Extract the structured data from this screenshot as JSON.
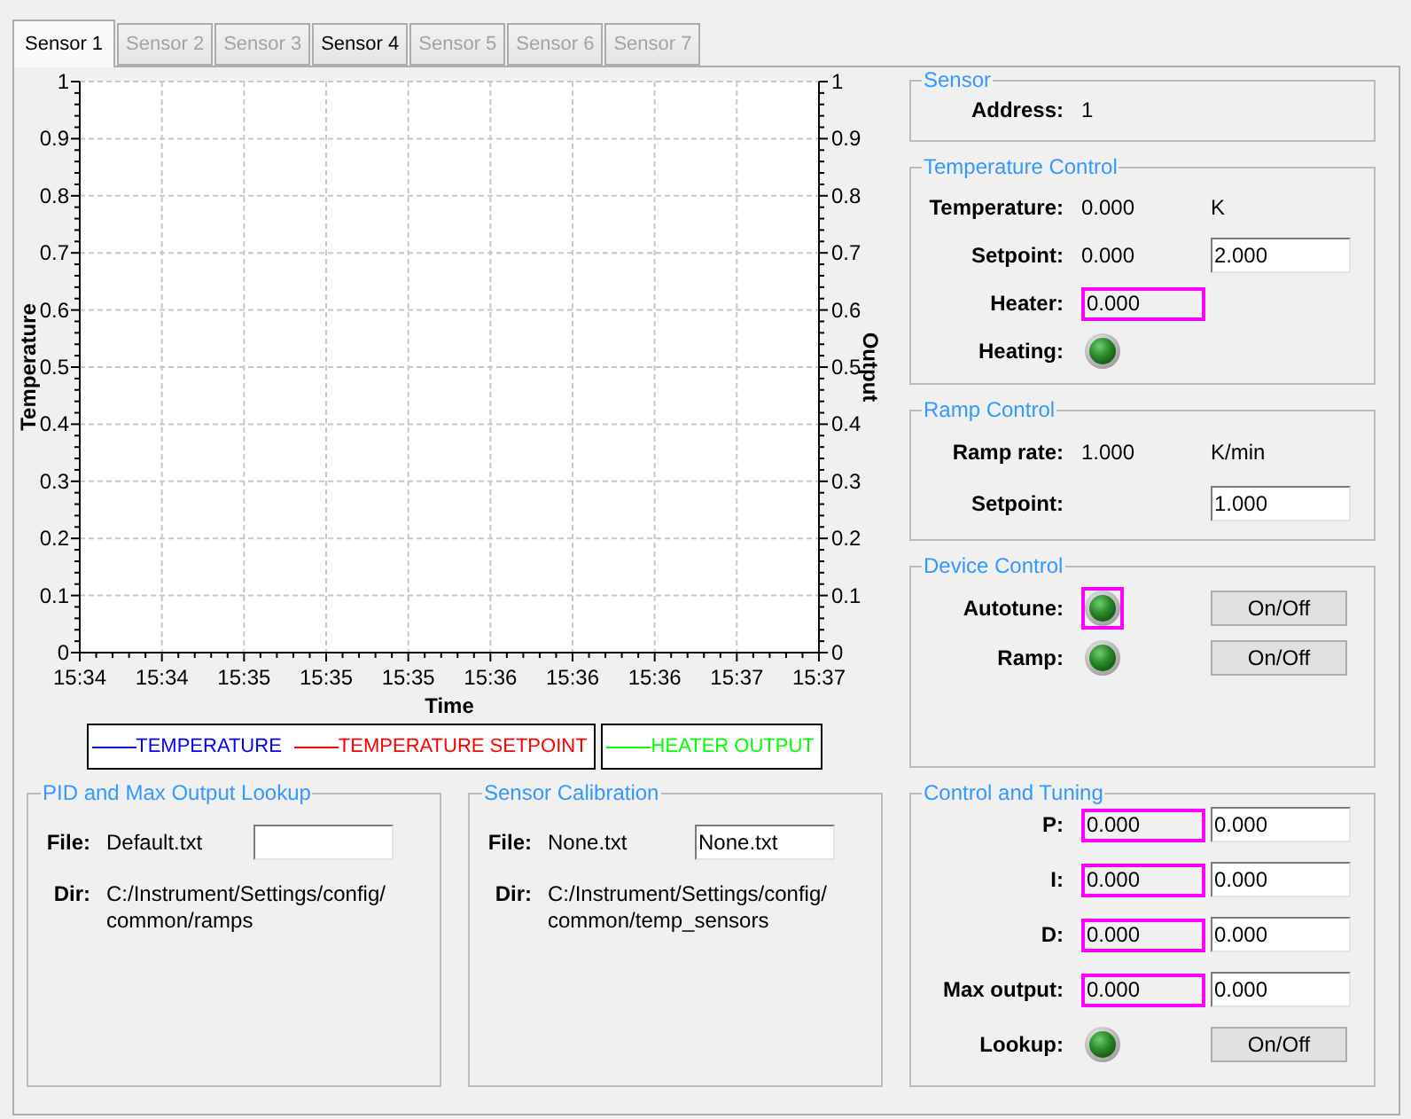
{
  "tabs": [
    {
      "label": "Sensor 1",
      "selected": true,
      "disabled": false
    },
    {
      "label": "Sensor 2",
      "selected": false,
      "disabled": true
    },
    {
      "label": "Sensor 3",
      "selected": false,
      "disabled": true
    },
    {
      "label": "Sensor 4",
      "selected": false,
      "disabled": false
    },
    {
      "label": "Sensor 5",
      "selected": false,
      "disabled": true
    },
    {
      "label": "Sensor 6",
      "selected": false,
      "disabled": true
    },
    {
      "label": "Sensor 7",
      "selected": false,
      "disabled": true
    }
  ],
  "chart": {
    "chart_data": {
      "type": "line",
      "xlabel": "Time",
      "ylabel": "Temperature",
      "categories": [
        "15:34",
        "15:34",
        "15:35",
        "15:35",
        "15:35",
        "15:36",
        "15:36",
        "15:36",
        "15:37",
        "15:37"
      ],
      "ylim": [
        0,
        1
      ],
      "yticks": [
        0,
        0.1,
        0.2,
        0.3,
        0.4,
        0.5,
        0.6,
        0.7,
        0.8,
        0.9,
        1
      ],
      "grid": true,
      "series": [
        {
          "name": "TEMPERATURE",
          "color": "#0000ff",
          "values": [
            null,
            null,
            null,
            null,
            null,
            null,
            null,
            null,
            null,
            null
          ]
        },
        {
          "name": "TEMPERATURE SETPOINT",
          "color": "#ff0000",
          "values": [
            null,
            null,
            null,
            null,
            null,
            null,
            null,
            null,
            null,
            null
          ]
        },
        {
          "name": "HEATER OUTPUT",
          "color": "#00ff00",
          "axis": "y2",
          "values": [
            null,
            null,
            null,
            null,
            null,
            null,
            null,
            null,
            null,
            null
          ]
        }
      ]
    },
    "right_axis": {
      "label": "Output",
      "ticks": [
        "1",
        "0.9",
        "0.8",
        "0.7",
        "0.6",
        "0.5",
        "0.4",
        "0.3",
        "0.2",
        "0.1",
        "0"
      ]
    }
  },
  "file_groups": [
    {
      "title": "PID and Max Output Lookup",
      "file_label": "File:",
      "file": "Default.txt",
      "dir_label": "Dir:",
      "dir": "C:/Instrument/Settings/config/common/ramps"
    },
    {
      "title": "Sensor Calibration",
      "file_label": "File:",
      "file": "None.txt",
      "file_field_value": "None.txt",
      "dir_label": "Dir:",
      "dir": "C:/Instrument/Settings/config/common/temp_sensors"
    }
  ],
  "control_groups": [
    {
      "title": "Sensor",
      "rows": [
        {
          "label": "Address:",
          "value": {
            "kind": "text",
            "text": "1"
          }
        }
      ]
    },
    {
      "title": "Temperature Control",
      "rows": [
        {
          "label": "Temperature:",
          "value": {
            "kind": "text",
            "text": "0.000"
          },
          "extra": {
            "kind": "text",
            "text": "K"
          }
        },
        {
          "label": "Setpoint:",
          "value": {
            "kind": "text",
            "text": "0.000"
          },
          "extra": {
            "kind": "input",
            "value": "2.000"
          }
        },
        {
          "label": "Heater:",
          "value": {
            "kind": "readout",
            "value": "0.000",
            "highlighted": true
          }
        },
        {
          "label": "Heating:",
          "value": {
            "kind": "indicator",
            "highlighted": false
          }
        }
      ]
    },
    {
      "title": "Ramp Control",
      "rows": [
        {
          "label": "Ramp rate:",
          "value": {
            "kind": "text",
            "text": "1.000"
          },
          "extra": {
            "kind": "text",
            "text": "K/min"
          }
        },
        {
          "label": "Setpoint:",
          "extra": {
            "kind": "input",
            "value": "1.000"
          }
        }
      ]
    },
    {
      "title": "Device Control",
      "rows": [
        {
          "label": "Autotune:",
          "value": {
            "kind": "indicator",
            "highlighted": true
          },
          "extra": {
            "kind": "button",
            "label": "On/Off"
          }
        },
        {
          "label": "Ramp:",
          "value": {
            "kind": "indicator",
            "highlighted": false
          },
          "extra": {
            "kind": "button",
            "label": "On/Off"
          }
        }
      ]
    },
    {
      "title": "Control and Tuning",
      "rows": [
        {
          "label": "P:",
          "value": {
            "kind": "readout",
            "value": "0.000",
            "highlighted": true
          },
          "extra": {
            "kind": "input",
            "value": "0.000"
          }
        },
        {
          "label": "I:",
          "value": {
            "kind": "readout",
            "value": "0.000",
            "highlighted": true
          },
          "extra": {
            "kind": "input",
            "value": "0.000"
          }
        },
        {
          "label": "D:",
          "value": {
            "kind": "readout",
            "value": "0.000",
            "highlighted": true
          },
          "extra": {
            "kind": "input",
            "value": "0.000"
          }
        },
        {
          "label": "Max output:",
          "value": {
            "kind": "readout",
            "value": "0.000",
            "highlighted": true
          },
          "extra": {
            "kind": "input",
            "value": "0.000"
          }
        },
        {
          "label": "Lookup:",
          "value": {
            "kind": "indicator",
            "highlighted": false
          },
          "extra": {
            "kind": "button",
            "label": "On/Off"
          }
        }
      ]
    }
  ]
}
